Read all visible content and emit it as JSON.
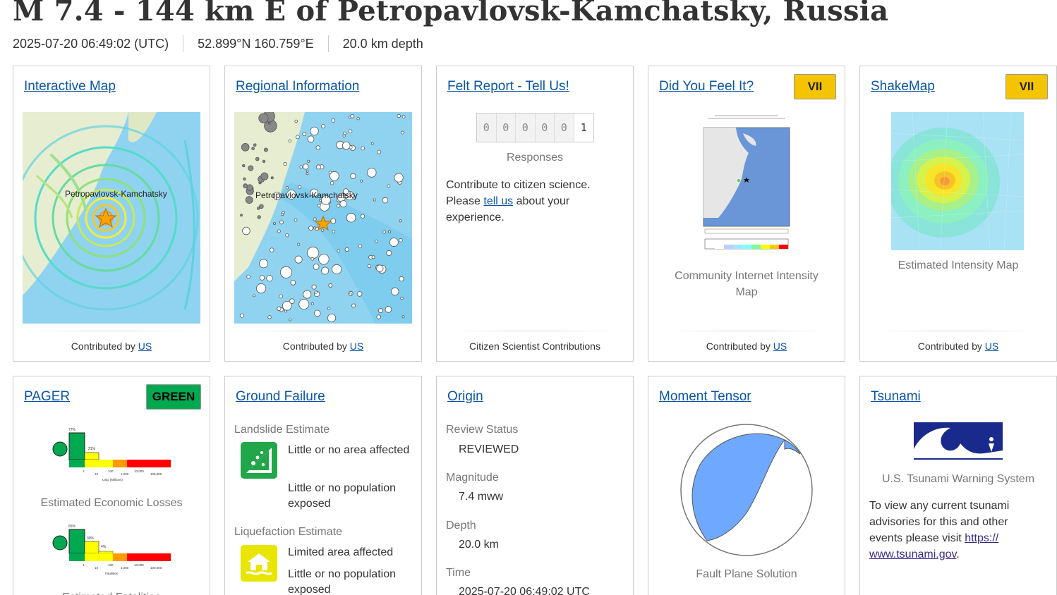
{
  "header": {
    "title": "M 7.4 - 144 km E of Petropavlovsk-Kamchatsky, Russia",
    "time": "2025-07-20 06:49:02 (UTC)",
    "location": "52.899°N 160.759°E",
    "depth": "20.0 km depth"
  },
  "interactive_map": {
    "title": "Interactive Map",
    "map_label": "Petropavlovsk-Kamchatsky",
    "contributed": "Contributed by",
    "contributor": "US"
  },
  "regional": {
    "title": "Regional Information",
    "map_label": "Petropavlovsk-Kamchatsky",
    "contributed": "Contributed by",
    "contributor": "US"
  },
  "felt_report": {
    "title": "Felt Report - Tell Us!",
    "digits": [
      "0",
      "0",
      "0",
      "0",
      "0",
      "1"
    ],
    "responses_label": "Responses",
    "text_1": "Contribute to citizen science.",
    "text_2": "Please",
    "link": "tell us",
    "text_3": "about your experience.",
    "footer": "Citizen Scientist Contributions"
  },
  "dyfi": {
    "title": "Did You Feel It?",
    "badge": "VII",
    "caption": "Community Internet Intensity Map",
    "contributed": "Contributed by",
    "contributor": "US"
  },
  "shakemap": {
    "title": "ShakeMap",
    "badge": "VII",
    "caption": "Estimated Intensity Map",
    "contributed": "Contributed by",
    "contributor": "US"
  },
  "pager": {
    "title": "PAGER",
    "badge": "GREEN",
    "econ_caption": "Estimated Economic Losses",
    "fatal_caption": "Estimated Fatalities",
    "econ_pcts": [
      "77%",
      "21%"
    ],
    "fatal_pcts": [
      "65%",
      "30%",
      "4%"
    ],
    "econ_axis_label": "USD (Millions)",
    "fatal_axis_label": "Fatalities"
  },
  "ground_failure": {
    "title": "Ground Failure",
    "landslide_head": "Landslide Estimate",
    "landslide_area": "Little or no area affected",
    "landslide_pop": "Little or no population exposed",
    "liquefaction_head": "Liquefaction Estimate",
    "liquefaction_area": "Limited area affected",
    "liquefaction_pop": "Little or no population exposed"
  },
  "origin": {
    "title": "Origin",
    "review_label": "Review Status",
    "review_value": "REVIEWED",
    "mag_label": "Magnitude",
    "mag_value": "7.4 mww",
    "depth_label": "Depth",
    "depth_value": "20.0 km",
    "time_label": "Time",
    "time_value": "2025-07-20 06:49:02 UTC"
  },
  "moment_tensor": {
    "title": "Moment Tensor",
    "caption": "Fault Plane Solution"
  },
  "tsunami": {
    "title": "Tsunami",
    "caption": "U.S. Tsunami Warning System",
    "text": "To view any current tsunami advisories for this and other events please visit",
    "link_1": "https://",
    "link_2": "www.tsunami.gov",
    "period": "."
  },
  "colors": {
    "link": "#0b56a4",
    "badge_yellow": "#f5c400",
    "badge_green": "#00a850",
    "ocean": "#8fd3f0",
    "beachball": "#6ea8ff"
  }
}
